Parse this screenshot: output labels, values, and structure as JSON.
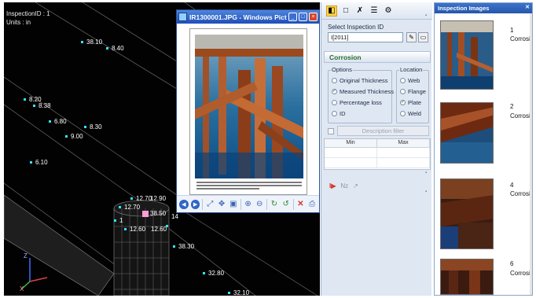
{
  "viewport": {
    "inspection_id_line": "InspectionID : 1",
    "units_line": "Units : in",
    "axis_z": "Z",
    "axis_x": "X",
    "labels": [
      "38.10",
      "8.40",
      "8.20",
      "8.38",
      "6.80",
      "8.30",
      "9.00",
      "6.10",
      "12.70",
      "12.90",
      "12.70",
      "38.50",
      "12.60",
      "12.60",
      "38.30",
      "32.80",
      "32.10"
    ],
    "partial_labels": [
      "14",
      "1"
    ]
  },
  "viewer": {
    "title": "IR1300001.JPG - Windows Pict...",
    "icons": [
      "app-icon",
      "minimize-icon",
      "maximize-icon",
      "close-icon"
    ],
    "toolbar_icons": [
      "previous-icon",
      "next-icon",
      "best-fit-icon",
      "actual-size-icon",
      "slideshow-icon",
      "zoom-in-icon",
      "zoom-out-icon",
      "rotate-clockwise-icon",
      "rotate-counterclockwise-icon",
      "delete-icon",
      "print-icon"
    ]
  },
  "panel": {
    "select_label": "Select Inspection ID",
    "select_value": "I[2011]",
    "section_title": "Corrosion",
    "options_label": "Options",
    "options": [
      {
        "label": "Original Thickness",
        "checked": false
      },
      {
        "label": "Measured Thickness",
        "checked": true
      },
      {
        "label": "Percentage loss",
        "checked": false
      },
      {
        "label": "ID",
        "checked": false
      }
    ],
    "location_label": "Location",
    "locations": [
      {
        "label": "Web",
        "checked": false
      },
      {
        "label": "Flange",
        "checked": false
      },
      {
        "label": "Plate",
        "checked": true
      },
      {
        "label": "Weld",
        "checked": false
      }
    ],
    "filter_button": "Description filter",
    "table_headers": [
      "Min",
      "Max"
    ],
    "bottom_tools": {
      "forward": "I▶",
      "go": "Nz",
      "pick": "↗"
    }
  },
  "images": {
    "title": "Inspection Images",
    "items": [
      {
        "number": "1",
        "label": "Corrosion"
      },
      {
        "number": "2",
        "label": "Corrosion"
      },
      {
        "number": "4",
        "label": "Corrosion"
      },
      {
        "number": "6",
        "label": "Corrosion"
      }
    ]
  },
  "colors": {
    "viewport_bg": "#020202",
    "marker": "#2fe6ff",
    "titlebar": "#2656aa",
    "section_title": "#2c6b2c",
    "close": "#d6472b"
  }
}
